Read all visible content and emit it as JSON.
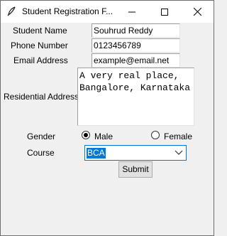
{
  "window": {
    "title": "Student Registration F...",
    "icon": "feather-icon",
    "controls": [
      "minimize-icon",
      "maximize-icon",
      "close-icon"
    ]
  },
  "form": {
    "name_label": "Student Name",
    "name_value": "Souhrud Reddy",
    "phone_label": "Phone Number",
    "phone_value": "0123456789",
    "email_label": "Email Address",
    "email_value": "example@email.net",
    "address_label": "Residential Address",
    "address_value": "A very real place,\nBangalore, Karnataka",
    "gender_label": "Gender",
    "gender_options": [
      {
        "label": "Male",
        "selected": true
      },
      {
        "label": "Female",
        "selected": false
      }
    ],
    "course_label": "Course",
    "course_value": "BCA",
    "submit_label": "Submit"
  }
}
